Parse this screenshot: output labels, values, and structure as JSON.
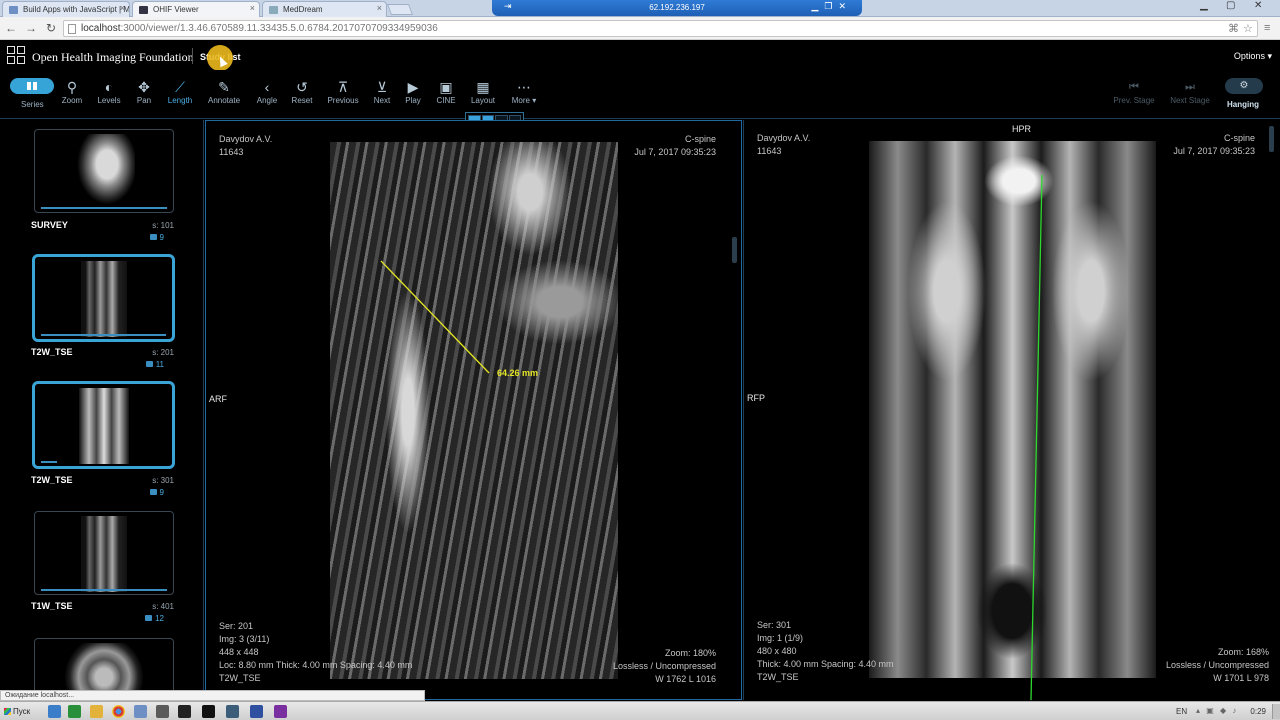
{
  "browser": {
    "tabs": [
      {
        "label": "Build Apps with JavaScript | M"
      },
      {
        "label": "OHIF Viewer"
      },
      {
        "label": "MedDream"
      }
    ],
    "remote_host": "62.192.236.197",
    "url_host": "localhost",
    "url_path": ":3000/viewer/1.3.46.670589.11.33435.5.0.6784.2017070709334959036"
  },
  "header": {
    "app_title": "Open Health Imaging Foundation",
    "study_list_link": "Study list",
    "options_label": "Options"
  },
  "toolbar": {
    "series": "Series",
    "zoom": "Zoom",
    "levels": "Levels",
    "pan": "Pan",
    "length": "Length",
    "annotate": "Annotate",
    "angle": "Angle",
    "reset": "Reset",
    "previous": "Previous",
    "next": "Next",
    "play": "Play",
    "cine": "CINE",
    "layout": "Layout",
    "more": "More",
    "prev_stage": "Prev. Stage",
    "next_stage": "Next Stage",
    "hanging": "Hanging",
    "active_tool": "Length",
    "layout_grid": {
      "rows": 4,
      "cols": 4,
      "selected_rows": 1,
      "selected_cols": 2
    }
  },
  "series_list": [
    {
      "name": "SURVEY",
      "series_number": "s: 101",
      "image_count": "9",
      "selected": false
    },
    {
      "name": "T2W_TSE",
      "series_number": "s: 201",
      "image_count": "11",
      "selected": true
    },
    {
      "name": "T2W_TSE",
      "series_number": "s: 301",
      "image_count": "9",
      "selected": true
    },
    {
      "name": "T1W_TSE",
      "series_number": "s: 401",
      "image_count": "12",
      "selected": false
    }
  ],
  "viewports": {
    "left": {
      "patient_name": "Davydov A.V.",
      "patient_id": "11643",
      "study_description": "C-spine",
      "study_date": "Jul 7, 2017 09:35:23",
      "orientation_left": "ARF",
      "series": "Ser: 201",
      "image": "Img: 3 (3/11)",
      "dimensions": "448 x 448",
      "slice_info": "Loc: 8.80 mm Thick: 4.00 mm Spacing: 4.40 mm",
      "series_description": "T2W_TSE",
      "zoom": "Zoom: 180%",
      "compression": "Lossless / Uncompressed",
      "window_level": "W 1762 L 1016",
      "measurement": {
        "label": "64.26 mm",
        "value_mm": 64.26
      }
    },
    "right": {
      "patient_name": "Davydov A.V.",
      "patient_id": "11643",
      "study_description": "C-spine",
      "study_date": "Jul 7, 2017 09:35:23",
      "orientation_top": "HPR",
      "orientation_left": "RFP",
      "series": "Ser: 301",
      "image": "Img: 1 (1/9)",
      "dimensions": "480 x 480",
      "slice_info": "Thick: 4.00 mm Spacing: 4.40 mm",
      "series_description": "T2W_TSE",
      "zoom": "Zoom: 168%",
      "compression": "Lossless / Uncompressed",
      "window_level": "W 1701 L 978"
    }
  },
  "status_text": "Ожидание localhost...",
  "taskbar": {
    "start": "Пуск",
    "language": "EN",
    "time": "0:29"
  },
  "colors": {
    "accent": "#3aa4d6",
    "measurement": "#e4e624",
    "reference_line": "#2ed82e"
  }
}
